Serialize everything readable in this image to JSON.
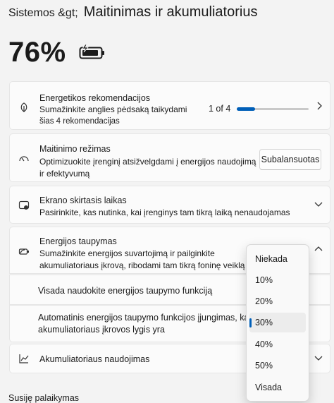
{
  "breadcrumb": {
    "parent": "Sistemos &gt;",
    "current": "Maitinimas ir akumuliatorius"
  },
  "battery": {
    "percent": "76%",
    "icon": "battery-charging-icon"
  },
  "recommendations": {
    "title": "Energetikos rekomendacijos",
    "desc_1": "Sumažinkite anglies pėdsaką taikydami",
    "desc_2": "šias 4 rekomendacijas",
    "progress_text": "1 of 4",
    "progress_fraction": 0.25,
    "icon": "leaf-icon"
  },
  "power_mode": {
    "title": "Maitinimo režimas",
    "desc_1": "Optimizuokite įrenginį atsižvelgdami į energijos naudojimą",
    "desc_2": "ir efektyvumą",
    "button": "Subalansuotas",
    "icon": "gauge-icon"
  },
  "screen_sleep": {
    "title": "Ekrano skirtasis laikas",
    "desc": "Pasirinkite, kas nutinka, kai įrenginys tam tikrą laiką nenaudojamas",
    "icon": "screen-sleep-icon"
  },
  "battery_saver": {
    "title": "Energijos taupymas",
    "desc_1": "Sumažinkite energijos suvartojimą ir pailginkite",
    "desc_2": "akumuliatoriaus įkrovą, ribodami tam tikrą foninę veiklą",
    "icon": "battery-saver-icon",
    "always_label": "Visada naudokite energijos taupymo funkciją",
    "auto_label_1": "Automatinis energijos taupymo funkcijos įjungimas, kai",
    "auto_label_2": "akumuliatoriaus įkrovos lygis yra"
  },
  "dropdown": {
    "options": [
      "Niekada",
      "10%",
      "20%",
      "30%",
      "40%",
      "50%",
      "Visada"
    ],
    "selected": "30%"
  },
  "battery_usage": {
    "title": "Akumuliatoriaus naudojimas",
    "icon": "chart-icon"
  },
  "related": {
    "title": "Susiję palaikymas"
  },
  "colors": {
    "accent": "#005fb8",
    "background": "#f3f3f3",
    "card": "#fbfbfb"
  }
}
